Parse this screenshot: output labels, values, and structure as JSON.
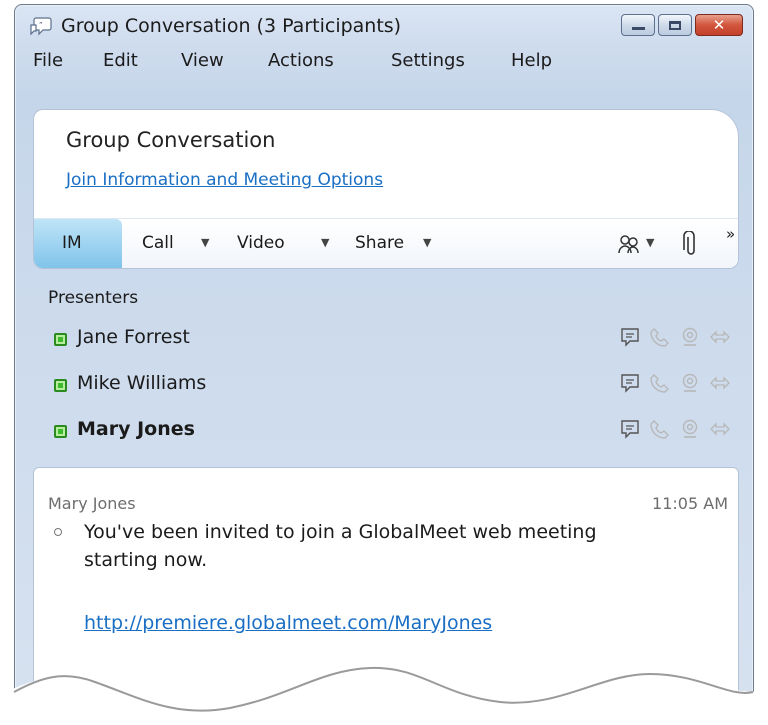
{
  "window": {
    "title": "Group Conversation (3 Participants)",
    "controls": {
      "minimize": "minimize",
      "maximize": "maximize",
      "close": "✕"
    }
  },
  "menu": [
    "File",
    "Edit",
    "View",
    "Actions",
    "Settings",
    "Help"
  ],
  "header": {
    "title": "Group Conversation",
    "link": "Join Information and Meeting Options"
  },
  "toolbar": {
    "im": "IM",
    "call": "Call",
    "video": "Video",
    "share": "Share",
    "caret": "▼",
    "more": "»"
  },
  "participants": {
    "section_label": "Presenters",
    "people": [
      {
        "name": "Jane Forrest",
        "bold": false
      },
      {
        "name": "Mike Williams",
        "bold": false
      },
      {
        "name": "Mary Jones",
        "bold": true
      }
    ],
    "status_color": "#3dbb2c"
  },
  "chat": {
    "sender": "Mary Jones",
    "time": "11:05 AM",
    "message": "You've been invited to join a GlobalMeet web meeting starting now.",
    "link": "http://premiere.globalmeet.com/MaryJones"
  },
  "colors": {
    "accent": "#1a6fc5",
    "im_tab": "#7fc3ea",
    "close_button": "#d2553c"
  }
}
